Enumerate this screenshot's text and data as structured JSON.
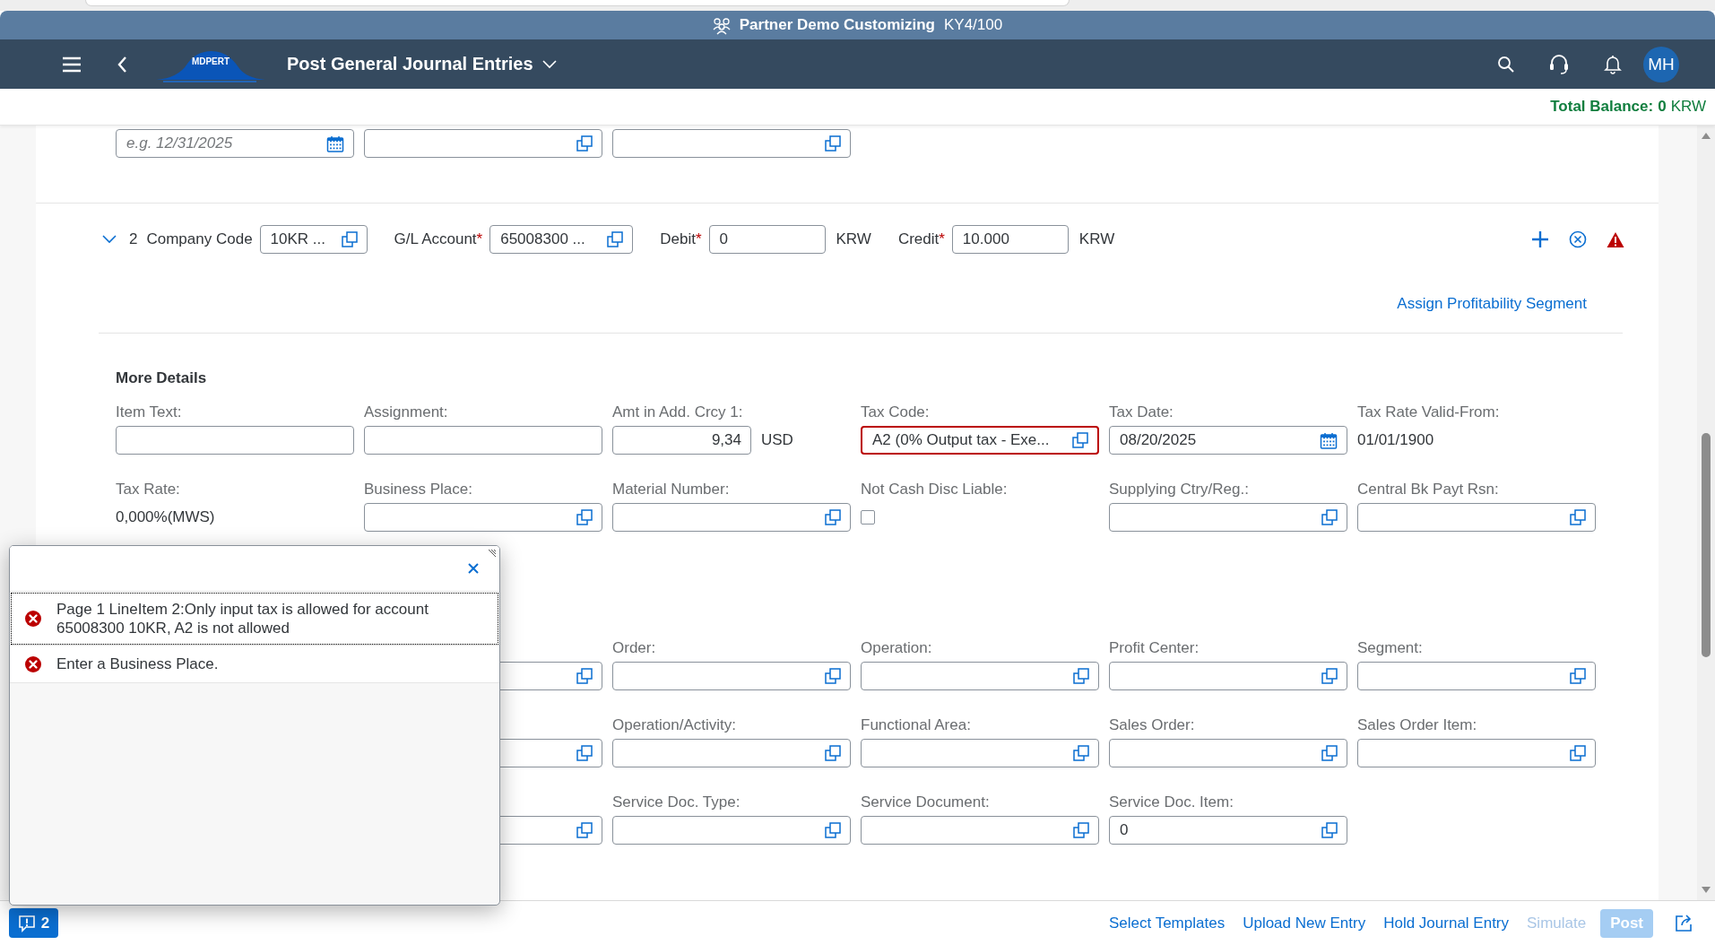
{
  "shell": {
    "title": "Partner Demo Customizing",
    "system": "KY4/100"
  },
  "header": {
    "logo_text": "MDPERT",
    "app_title": "Post General Journal Entries",
    "avatar": "MH"
  },
  "balance": {
    "label": "Total Balance:",
    "amount": "0",
    "currency": "KRW"
  },
  "top_row": [
    {
      "kind": "date",
      "placeholder": "e.g. 12/31/2025"
    },
    {
      "kind": "value_help"
    },
    {
      "kind": "value_help"
    }
  ],
  "line_item": {
    "expanded": true,
    "number": "2",
    "fields": [
      {
        "label": "Company Code",
        "value": "10KR ...",
        "kind": "value_help"
      },
      {
        "label": "G/L Account",
        "required_mark": "*",
        "value": "65008300 ...",
        "kind": "value_help"
      },
      {
        "label": "Debit",
        "required_mark": "*",
        "value": "0",
        "kind": "input",
        "unit": "KRW"
      },
      {
        "label": "Credit",
        "required_mark": "*",
        "value": "10.000",
        "kind": "input",
        "unit": "KRW"
      }
    ],
    "link": "Assign Profitability Segment"
  },
  "details": {
    "title": "More Details",
    "rows": [
      [
        {
          "label": "Item Text:",
          "kind": "input",
          "error": false
        },
        {
          "label": "Assignment:",
          "kind": "input",
          "error": false
        },
        {
          "label": "Amt in Add. Crcy 1:",
          "kind": "amount",
          "value": "9,34",
          "unit": "USD",
          "error": false
        },
        {
          "label": "Tax Code:",
          "kind": "value_help",
          "value": "A2 (0% Output tax -  Exe...",
          "error": true
        },
        {
          "label": "Tax Date:",
          "kind": "date",
          "value": "08/20/2025",
          "error": false
        },
        {
          "label": "Tax Rate Valid-From:",
          "kind": "text",
          "value": "01/01/1900",
          "error": false
        }
      ],
      [
        {
          "label": "Tax Rate:",
          "kind": "text",
          "value": "0,000%(MWS)",
          "error": false
        },
        {
          "label": "Business Place:",
          "kind": "value_help",
          "error": false
        },
        {
          "label": "Material Number:",
          "kind": "value_help",
          "error": false
        },
        {
          "label": "Not Cash Disc Liable:",
          "kind": "checkbox",
          "checked": false,
          "error": false
        },
        {
          "label": "Supplying Ctry/Reg.:",
          "kind": "value_help",
          "error": false
        },
        {
          "label": "Central Bk Payt Rsn:",
          "kind": "value_help",
          "error": false
        }
      ],
      [
        null,
        {
          "kind": "value_help",
          "error": false
        },
        {
          "label": "Order:",
          "kind": "value_help",
          "error": false
        },
        {
          "label": "Operation:",
          "kind": "value_help",
          "error": false
        },
        {
          "label": "Profit Center:",
          "kind": "value_help",
          "error": false
        },
        {
          "label": "Segment:",
          "kind": "value_help",
          "error": false
        }
      ],
      [
        null,
        {
          "kind": "value_help",
          "error": false
        },
        {
          "label": "Operation/Activity:",
          "kind": "value_help",
          "error": false
        },
        {
          "label": "Functional Area:",
          "kind": "value_help",
          "error": false
        },
        {
          "label": "Sales Order:",
          "kind": "value_help",
          "error": false
        },
        {
          "label": "Sales Order Item:",
          "kind": "value_help",
          "error": false
        }
      ],
      [
        null,
        {
          "kind": "value_help",
          "error": false
        },
        {
          "label": "Service Doc. Type:",
          "kind": "value_help",
          "error": false
        },
        {
          "label": "Service Document:",
          "kind": "value_help",
          "error": false
        },
        {
          "label": "Service Doc. Item:",
          "kind": "value_help",
          "value": "0",
          "error": false
        }
      ]
    ]
  },
  "messages": {
    "items": [
      {
        "kind": "error",
        "text": "Page 1 LineItem 2:Only input tax is allowed for account 65008300 10KR, A2 is not allowed",
        "selected": true
      },
      {
        "kind": "error",
        "text": "Enter a Business Place.",
        "selected": false
      }
    ]
  },
  "footer": {
    "message_count": "2",
    "actions": [
      {
        "label": "Select Templates",
        "kind": "link",
        "disabled": false
      },
      {
        "label": "Upload New Entry",
        "kind": "link",
        "disabled": false
      },
      {
        "label": "Hold Journal Entry",
        "kind": "link",
        "disabled": false
      },
      {
        "label": "Simulate",
        "kind": "link",
        "disabled": true
      },
      {
        "label": "Post",
        "kind": "button",
        "disabled": true
      }
    ]
  }
}
